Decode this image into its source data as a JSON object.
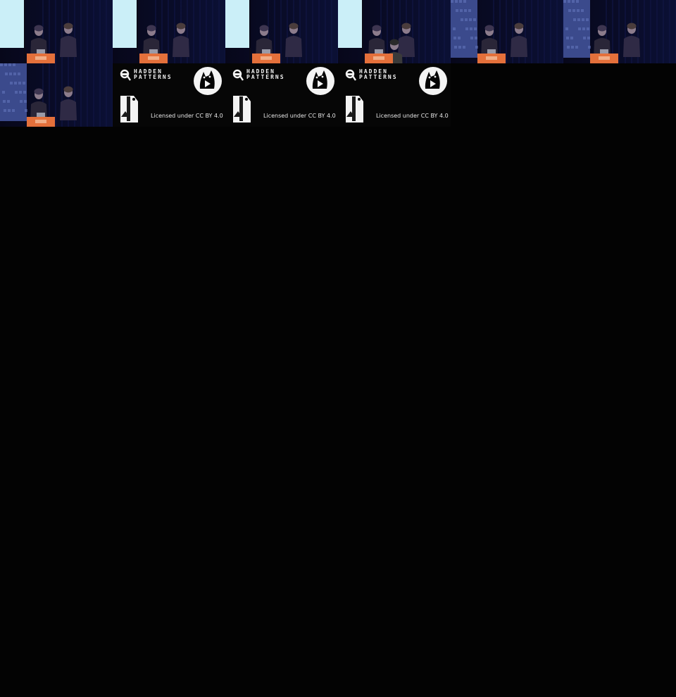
{
  "contact_sheet": {
    "frames": [
      {
        "kind": "stage",
        "screen": "light",
        "presenters": 2,
        "note": ""
      },
      {
        "kind": "stage",
        "screen": "light",
        "presenters": 2,
        "note": ""
      },
      {
        "kind": "stage",
        "screen": "light",
        "presenters": 2,
        "note": ""
      },
      {
        "kind": "stage",
        "screen": "light",
        "presenters": 3,
        "note": ""
      },
      {
        "kind": "stage",
        "screen": "pattern",
        "presenters": 2,
        "note": ""
      },
      {
        "kind": "stage",
        "screen": "pattern",
        "presenters": 2,
        "note": ""
      },
      {
        "kind": "stage",
        "screen": "pattern",
        "presenters": 2,
        "note": ""
      },
      {
        "kind": "endcard"
      },
      {
        "kind": "endcard"
      },
      {
        "kind": "endcard"
      }
    ],
    "endcard": {
      "logo_line_1": "HADDEN",
      "logo_line_2": "PATTERNS",
      "license": "Licensed under CC BY 4.0",
      "cc_icon": "cc-icon",
      "mascot_icon": "mascot-icon",
      "tag_icon": "entropia-tag-icon"
    },
    "colors": {
      "background": "#030303",
      "stage_dark": "#07071a",
      "curtain": "#0b1035",
      "screen_light": "#cbeff8",
      "screen_pattern": "#3b4a8c",
      "lectern": "#e4703b",
      "shirt": "#2a2638"
    }
  }
}
